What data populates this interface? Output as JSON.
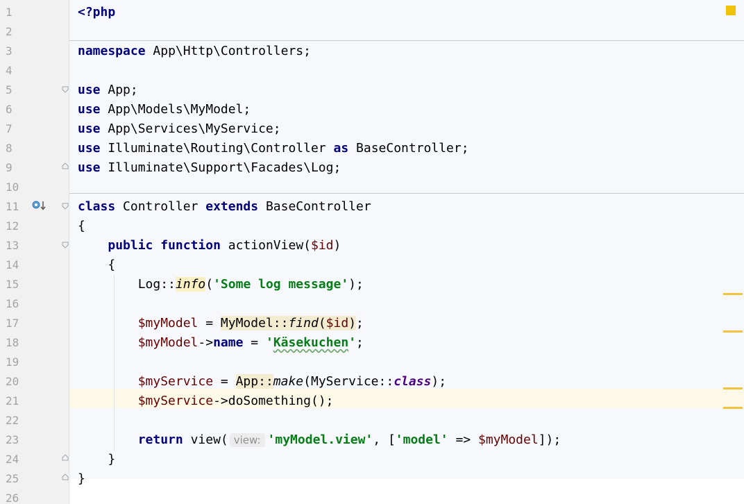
{
  "gutter": {
    "line_numbers": [
      "1",
      "2",
      "3",
      "4",
      "5",
      "6",
      "7",
      "8",
      "9",
      "10",
      "11",
      "12",
      "13",
      "14",
      "15",
      "16",
      "17",
      "18",
      "19",
      "20",
      "21",
      "22",
      "23",
      "24",
      "25",
      "26"
    ]
  },
  "code": {
    "l1_open": "<?php",
    "l3_kw": "namespace",
    "l3_ns": "App\\Http\\Controllers;",
    "use_kw": "use",
    "l5_name": "App;",
    "l6_name": "App\\Models\\MyModel;",
    "l7_name": "App\\Services\\MyService;",
    "l8_name": "Illuminate\\Routing\\Controller",
    "l8_as": "as",
    "l8_alias": "BaseController;",
    "l9_name": "Illuminate\\Support\\Facades\\Log;",
    "l11_class_kw": "class",
    "l11_class_name": "Controller",
    "l11_extends_kw": "extends",
    "l11_parent": "BaseController",
    "l12_brace": "{",
    "l13_public": "public",
    "l13_function": "function",
    "l13_name": "actionView(",
    "l13_param": "$id",
    "l13_close": ")",
    "l14_brace": "{",
    "l15_class": "Log::",
    "l15_method": "info",
    "l15_open": "(",
    "l15_string": "'Some log message'",
    "l15_close": ");",
    "l17_var": "$myModel",
    "l17_eq": " = ",
    "l17_call": "MyModel::",
    "l17_method": "find",
    "l17_open": "(",
    "l17_param": "$id",
    "l17_close": ")",
    "l17_semi": ";",
    "l18_var": "$myModel",
    "l18_arrow": "->",
    "l18_prop": "name",
    "l18_eq": " = ",
    "l18_string_a": "'",
    "l18_string_b": "Käsekuchen",
    "l18_string_c": "'",
    "l18_semi": ";",
    "l20_var": "$myService",
    "l20_eq": " = ",
    "l20_call": "App::",
    "l20_method": "make",
    "l20_open": "(MyService::",
    "l20_const": "class",
    "l20_close": ");",
    "l21_var": "$myService",
    "l21_call": "->doSomething();",
    "l23_return": "return",
    "l23_fn": " view(",
    "l23_hint": "view:",
    "l23_string": "'myModel.view'",
    "l23_comma": ", [",
    "l23_key": "'model'",
    "l23_arrow": " => ",
    "l23_var": "$myModel",
    "l23_close": "]);",
    "l24_brace": "}",
    "l25_brace": "}"
  },
  "colors": {
    "keyword": "#000080",
    "string": "#067d17",
    "variable": "#660000",
    "current_line": "#fcfae6",
    "warning_marker": "#f0c20a"
  }
}
